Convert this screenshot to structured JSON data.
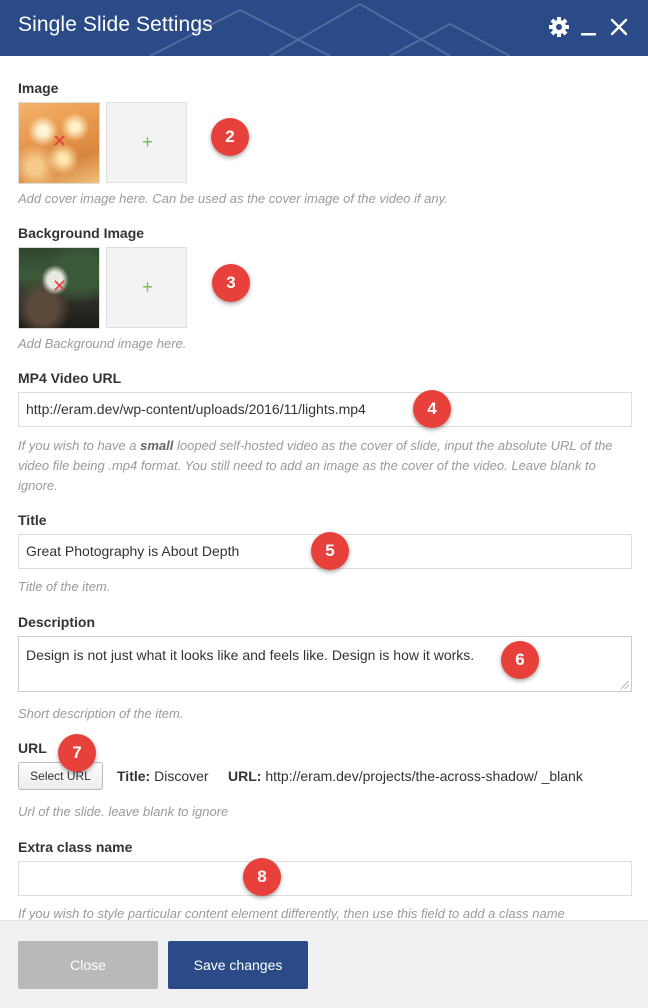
{
  "dialog": {
    "title": "Single Slide Settings",
    "accent_color": "#2a4b87",
    "icons": [
      "gear-icon",
      "minimize-icon",
      "close-icon"
    ]
  },
  "fields": {
    "image": {
      "label": "Image",
      "remove_glyph": "✕",
      "add_glyph": "+",
      "help": "Add cover image here. Can be used as the cover image of the video if any."
    },
    "background_image": {
      "label": "Background Image",
      "remove_glyph": "✕",
      "add_glyph": "+",
      "help": "Add Background image here."
    },
    "mp4": {
      "label": "MP4 Video URL",
      "value": "http://eram.dev/wp-content/uploads/2016/11/lights.mp4",
      "help_before": "If you wish to have a ",
      "help_bold": "small",
      "help_after": " looped self-hosted video as the cover of slide, input the absolute URL of the video file being .mp4 format. You still need to add an image as the cover of the video. Leave blank to ignore."
    },
    "title": {
      "label": "Title",
      "value": "Great Photography is About Depth",
      "help": "Title of the item."
    },
    "description": {
      "label": "Description",
      "value": "Design is not just what it looks like and feels like. Design is how it works.",
      "help": "Short description of the item."
    },
    "url": {
      "label": "URL",
      "button": "Select URL",
      "title_key": "Title:",
      "title_value": "Discover",
      "url_key": "URL:",
      "url_value": "http://eram.dev/projects/the-across-shadow/",
      "target": "_blank",
      "help": "Url of the slide. leave blank to ignore"
    },
    "extra_class": {
      "label": "Extra class name",
      "value": "",
      "help": "If you wish to style particular content element differently, then use this field to add a class name"
    }
  },
  "annotations": [
    "2",
    "3",
    "4",
    "5",
    "6",
    "7",
    "8"
  ],
  "annotation_color": "#e8403a",
  "footer": {
    "close_label": "Close",
    "save_label": "Save changes"
  }
}
